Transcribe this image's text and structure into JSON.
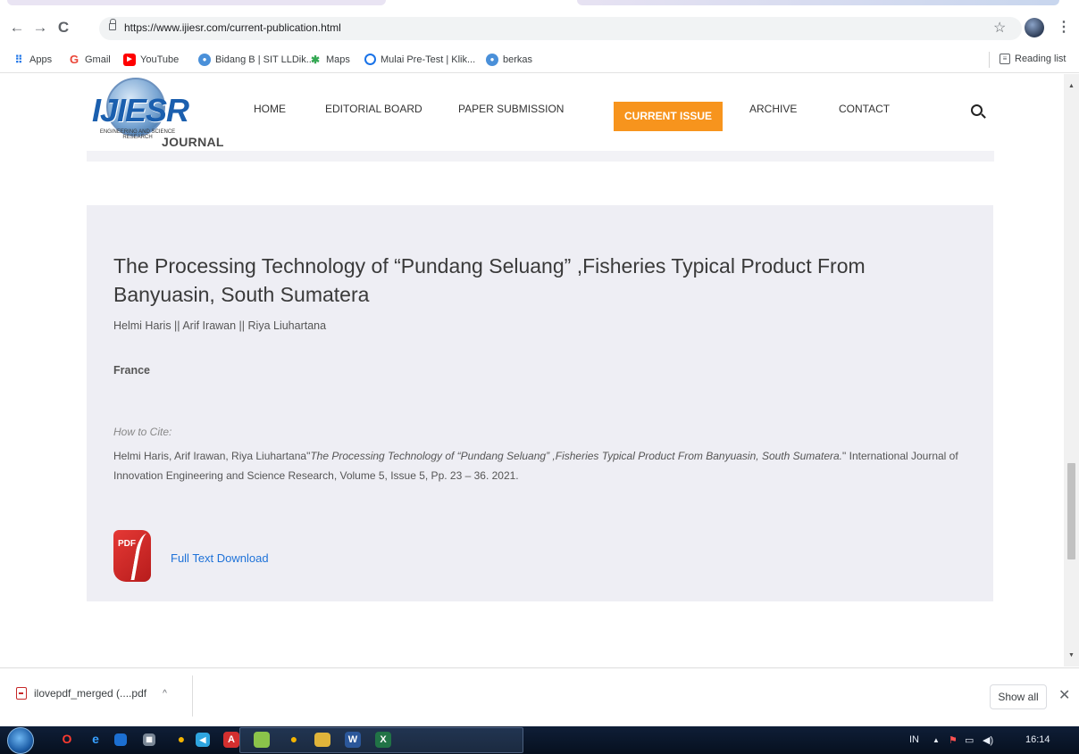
{
  "browser": {
    "url": "https://www.ijiesr.com/current-publication.html",
    "reading_list_label": "Reading list",
    "bookmarks": [
      {
        "label": "Apps",
        "icon": "apps-grid-icon",
        "color": "#1a73e8"
      },
      {
        "label": "Gmail",
        "icon": "google-g-icon",
        "color": "#ea4335"
      },
      {
        "label": "YouTube",
        "icon": "youtube-icon",
        "color": "#ff0000"
      },
      {
        "label": "Bidang B | SIT LLDik...",
        "icon": "globe-icon",
        "color": "#4a90d9"
      },
      {
        "label": "Maps",
        "icon": "maps-pin-icon",
        "color": "#34a853"
      },
      {
        "label": "Mulai Pre-Test | Klik...",
        "icon": "circle-o-icon",
        "color": "#1a73e8"
      },
      {
        "label": "berkas",
        "icon": "globe-icon",
        "color": "#4a90d9"
      }
    ]
  },
  "site": {
    "logo_text": "IJIESR",
    "logo_arc_text": "ENGINEERING AND SCIENCE RESEARCH",
    "journal_label": "JOURNAL",
    "nav": [
      {
        "label": "HOME"
      },
      {
        "label": "EDITORIAL BOARD"
      },
      {
        "label": "PAPER SUBMISSION"
      },
      {
        "label": "CURRENT ISSUE"
      },
      {
        "label": "ARCHIVE"
      },
      {
        "label": "CONTACT"
      }
    ],
    "accent_color": "#f7941d"
  },
  "article": {
    "title": "The Processing Technology of “Pundang Seluang” ,Fisheries Typical Product From Banyuasin, South Sumatera",
    "authors": "Helmi Haris || Arif Irawan || Riya Liuhartana",
    "country": "France",
    "cite_label": "How to Cite:",
    "cite_authors": "Helmi Haris, Arif Irawan, Riya Liuhartana\"",
    "cite_title": "The Processing Technology of “Pundang Seluang” ,Fisheries Typical Product From Banyuasin, South Sumatera.",
    "cite_title_close": "\"",
    "cite_journal": "International Journal of Innovation Engineering and Science Research, Volume 5, Issue 5, Pp. 23 – 36. 2021.",
    "pdf_badge": "PDF",
    "download_label": "Full Text Download"
  },
  "downloads": {
    "file_label": "ilovepdf_merged (....pdf",
    "show_all_label": "Show all"
  },
  "taskbar": {
    "language": "IN",
    "clock": "16:14"
  }
}
